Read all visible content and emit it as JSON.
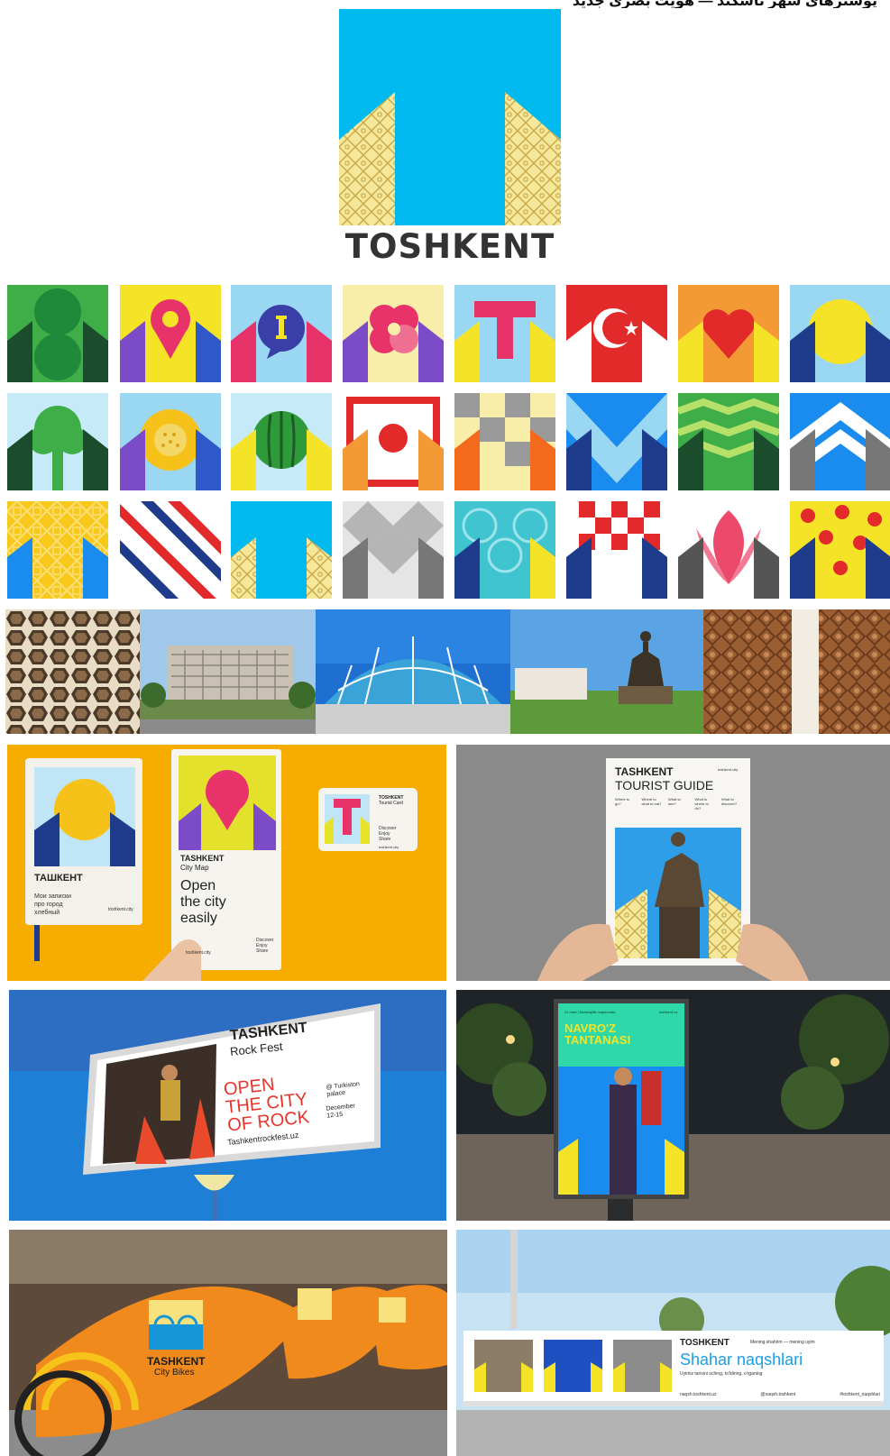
{
  "top_strip": {
    "text": "پوسترهای شهر تاشکند — هویت بصری جدید"
  },
  "logo": {
    "wordmark": "TOSHKENT"
  },
  "colors": {
    "cyan": "#00b9ee",
    "yellow_pattern": "#f6e89a",
    "dark": "#333333",
    "orange_bg": "#f6ad00",
    "bike_orange": "#f08a1c"
  },
  "icon_tiles": [
    [
      "trees-icon",
      "map-pin-icon",
      "info-bubble-icon",
      "flower-icon",
      "letter-t-icon",
      "crescent-star-flag-icon",
      "heart-icon",
      "sun-arch-icon"
    ],
    [
      "tree-icon",
      "bread-icon",
      "watermelon-icon",
      "red-frame-icon",
      "checker-pattern-icon",
      "m-chevron-icon",
      "green-zigzag-icon",
      "white-chevron-icon"
    ],
    [
      "star-pattern-icon",
      "diagonal-stripes-icon",
      "toshkent-t-icon",
      "grey-diamonds-icon",
      "teal-circles-icon",
      "red-checker-icon",
      "tulip-icon",
      "red-dots-icon"
    ]
  ],
  "photos": [
    "hexagon-facade",
    "state-museum",
    "chorsu-bazaar-dome",
    "amir-temur-monument",
    "carved-wooden-door"
  ],
  "mockups": {
    "notebook": {
      "brand": "ТАШКЕНТ",
      "lines": [
        "Мои записки",
        "про город",
        "хлебный"
      ],
      "url": "toshkent.city"
    },
    "city_map": {
      "brand": "TASHKENT",
      "subtitle": "City Map",
      "headline": [
        "Open",
        "the city",
        "easily"
      ],
      "url": "toshkent.city",
      "verbs": [
        "Discover",
        "Enjoy",
        "Share"
      ]
    },
    "tourist_card": {
      "brand": "TOSHKENT",
      "subtitle": "Tourist Card",
      "verbs": [
        "Discover",
        "Enjoy",
        "Share"
      ],
      "url": "toshkent.city"
    },
    "guide": {
      "brand": "TASHKENT",
      "title": "TOURIST GUIDE",
      "url": "toshkent.city",
      "questions": [
        "Where to go?",
        "Where to what to eat?",
        "What to see?",
        "What to where to do?",
        "What to discover?"
      ]
    },
    "billboard_rock": {
      "brand": "TASHKENT",
      "event": "Rock Fest",
      "headline": [
        "OPEN",
        "THE CITY",
        "OF ROCK"
      ],
      "venue": [
        "@ Turkiston",
        "palace"
      ],
      "dates": [
        "December",
        "12-15"
      ],
      "url": "Tashkentrockfest.uz"
    },
    "navroz": {
      "title": [
        "NAVRO'Z",
        "TANTANASI"
      ],
      "date_line": "21 mart | Mustaqillik maydonida",
      "url": "toshkent.uz"
    },
    "bikes": {
      "brand": "TASHKENT",
      "label": "City Bikes"
    },
    "naqsh_billboard": {
      "brand": "TOSHKENT",
      "tagline": "Mening shahrim — mening uyim",
      "title": "Shahar naqshlari",
      "subtitle": "Uyimiz tarixini oching, to'ldiring, o'rganing",
      "links": [
        "naqsh.toshkent.uz",
        "@naqsh.toshkent",
        "#toshkent_naqshlari"
      ]
    }
  }
}
